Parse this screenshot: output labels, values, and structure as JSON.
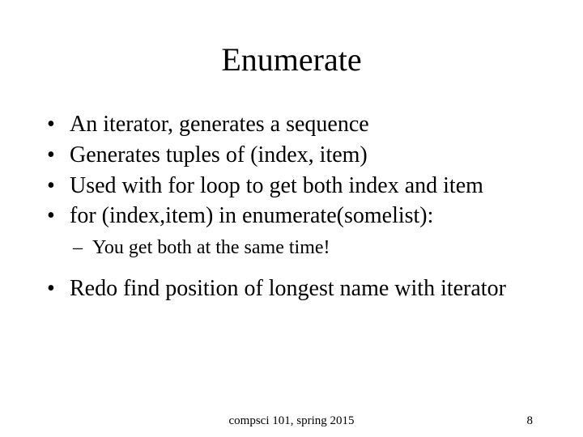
{
  "title": "Enumerate",
  "bullets": {
    "b0": "An iterator, generates a sequence",
    "b1": "Generates tuples of (index, item)",
    "b2": "Used with for loop to get both index and item",
    "b3": "for (index,item) in enumerate(somelist):",
    "sub0": "You get both at the same time!",
    "b4": "Redo find position of longest name with iterator"
  },
  "footer": {
    "center": "compsci 101, spring 2015",
    "page": "8"
  }
}
